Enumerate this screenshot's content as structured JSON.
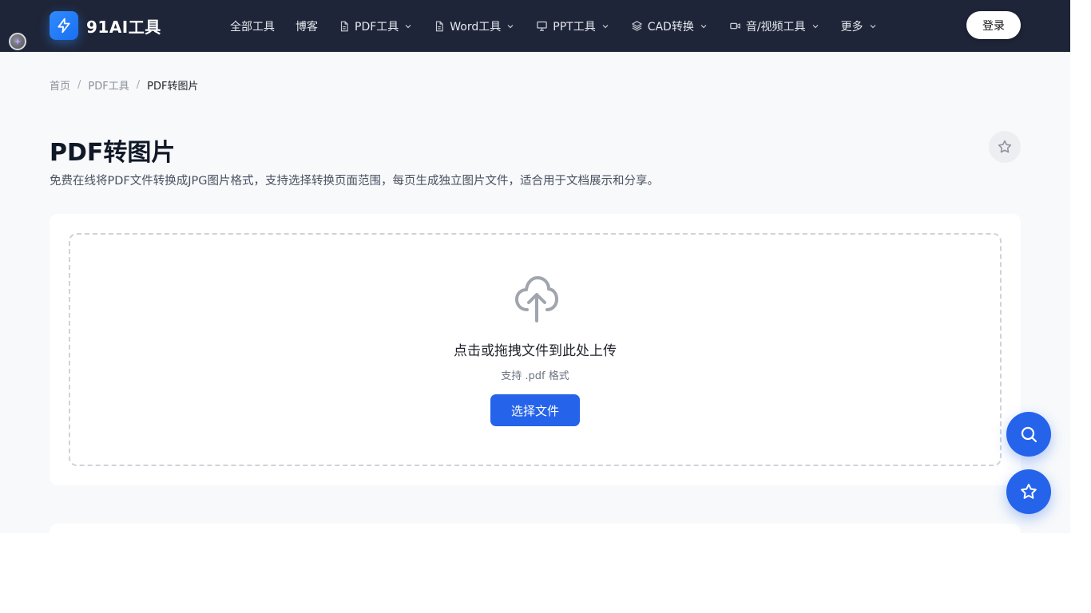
{
  "brand": {
    "name": "91AI工具",
    "logo_icon": "lightning-icon",
    "accent": "#2563eb"
  },
  "nav": {
    "items": [
      {
        "label": "全部工具",
        "icon": "",
        "dropdown": false
      },
      {
        "label": "博客",
        "icon": "",
        "dropdown": false
      },
      {
        "label": "PDF工具",
        "icon": "file-icon",
        "dropdown": true
      },
      {
        "label": "Word工具",
        "icon": "file-icon",
        "dropdown": true
      },
      {
        "label": "PPT工具",
        "icon": "presentation-icon",
        "dropdown": true
      },
      {
        "label": "CAD转换",
        "icon": "layers-icon",
        "dropdown": true
      },
      {
        "label": "音/视频工具",
        "icon": "video-icon",
        "dropdown": true
      },
      {
        "label": "更多",
        "icon": "",
        "dropdown": true
      }
    ],
    "login_label": "登录"
  },
  "breadcrumb": {
    "home": "首页",
    "parent": "PDF工具",
    "current": "PDF转图片",
    "separator": "/"
  },
  "page": {
    "title": "PDF转图片",
    "description": "免费在线将PDF文件转换成JPG图片格式，支持选择转换页面范围，每页生成独立图片文件，适合用于文档展示和分享。"
  },
  "upload": {
    "icon": "cloud-upload-icon",
    "prompt": "点击或拖拽文件到此处上传",
    "supported": "支持 .pdf 格式",
    "button_label": "选择文件"
  },
  "floating_actions": [
    {
      "icon": "search-icon"
    },
    {
      "icon": "star-icon"
    }
  ]
}
